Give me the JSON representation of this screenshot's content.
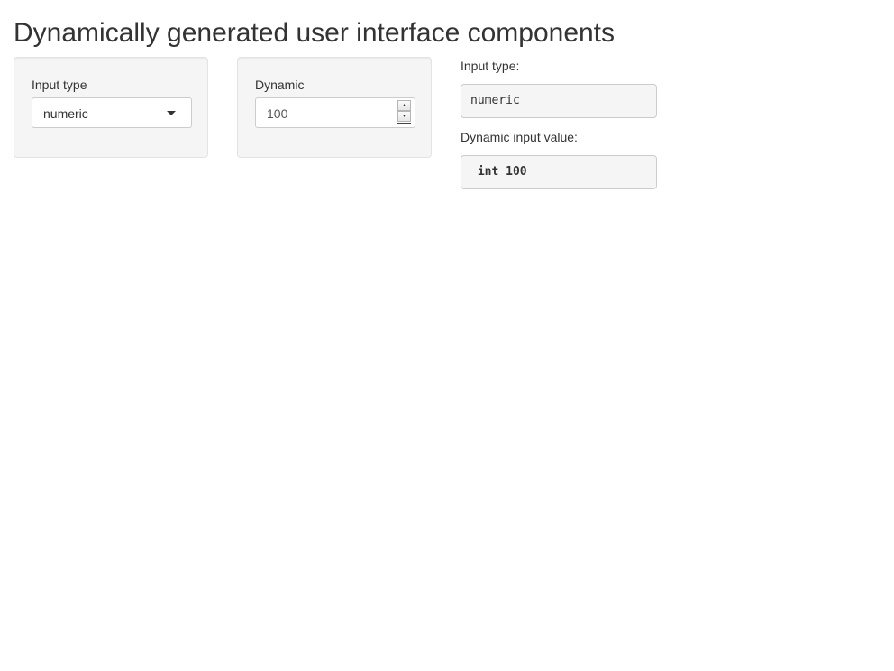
{
  "title": "Dynamically generated user interface components",
  "input_type_panel": {
    "label": "Input type",
    "selected": "numeric"
  },
  "dynamic_panel": {
    "label": "Dynamic",
    "value": "100",
    "spin_up": "▴",
    "spin_down": "▾"
  },
  "outputs": {
    "input_type_label": "Input type:",
    "input_type_value": "numeric",
    "dynamic_value_label": "Dynamic input value:",
    "dynamic_value": " int 100"
  }
}
